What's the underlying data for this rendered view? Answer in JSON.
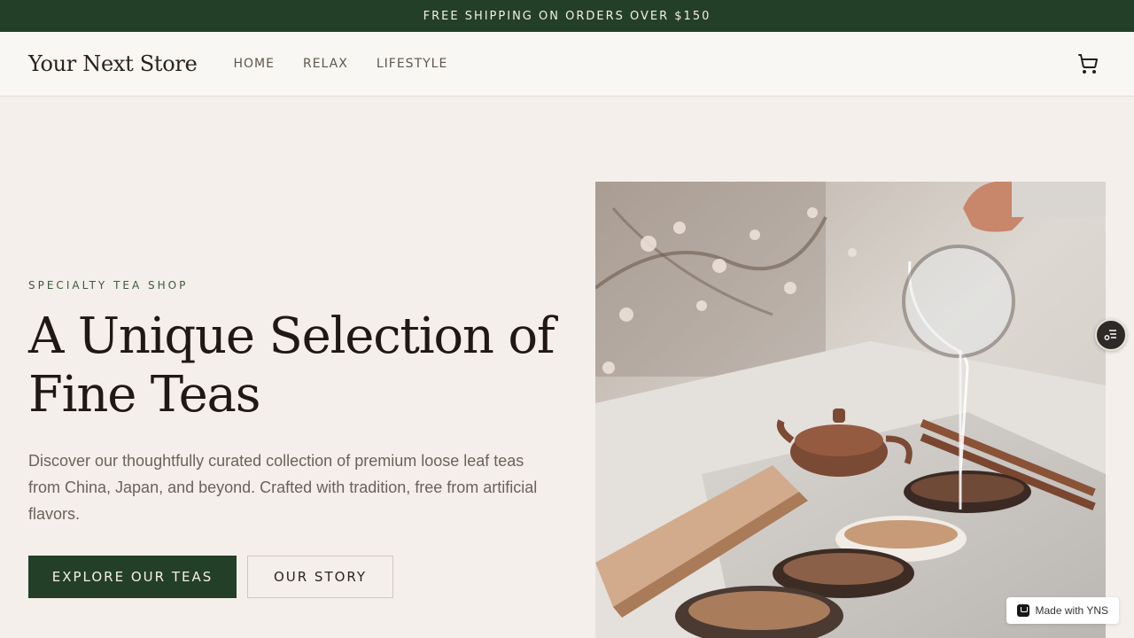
{
  "announcement": "FREE SHIPPING ON ORDERS OVER $150",
  "header": {
    "logo": "Your Next Store",
    "nav": [
      "HOME",
      "RELAX",
      "LIFESTYLE"
    ]
  },
  "hero": {
    "eyebrow": "SPECIALTY TEA SHOP",
    "title_line1": "A Unique Selection of",
    "title_line2": "Fine Teas",
    "description": "Discover our thoughtfully curated collection of premium loose leaf teas from China, Japan, and beyond. Crafted with tradition, free from artificial flavors.",
    "primary_button": "EXPLORE OUR TEAS",
    "secondary_button": "OUR STORY"
  },
  "badge": "Made with YNS",
  "colors": {
    "brand_green": "#243f27",
    "background": "#f4efea"
  },
  "icons": [
    "cart-icon",
    "settings-toggle-icon",
    "yns-logo-icon"
  ]
}
